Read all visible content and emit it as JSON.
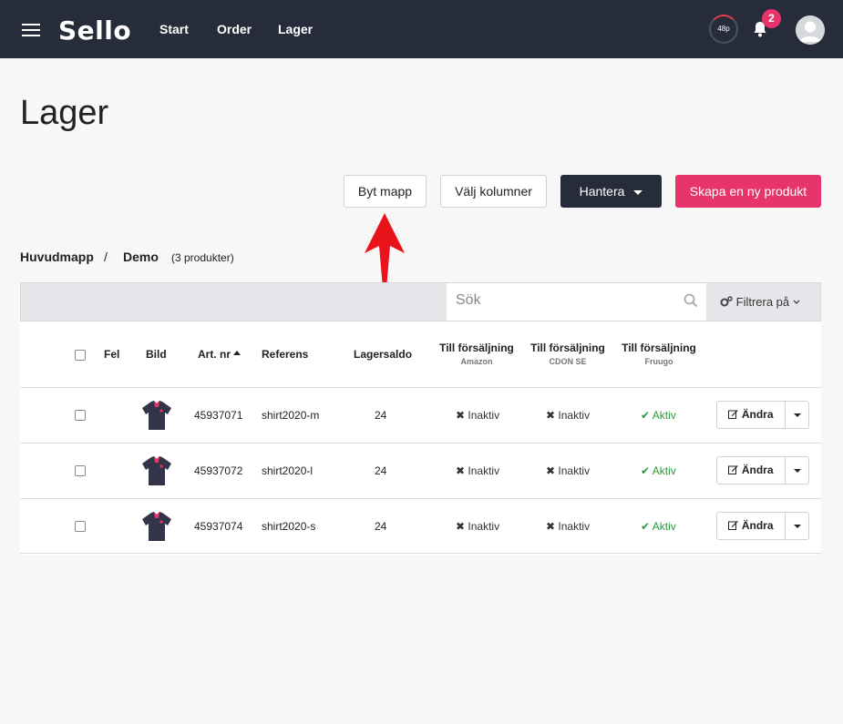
{
  "header": {
    "logo": "Sello",
    "nav": [
      "Start",
      "Order",
      "Lager"
    ],
    "speed_label": "48p",
    "notification_count": "2"
  },
  "page": {
    "title": "Lager"
  },
  "toolbar": {
    "change_folder": "Byt mapp",
    "select_columns": "Välj kolumner",
    "manage": "Hantera",
    "create_product": "Skapa en ny produkt"
  },
  "breadcrumb": {
    "root": "Huvudmapp",
    "separator": "/",
    "current": "Demo",
    "count": "(3 produkter)"
  },
  "search": {
    "placeholder": "Sök",
    "filter_label": "Filtrera på"
  },
  "table": {
    "columns": {
      "error": "Fel",
      "image": "Bild",
      "art_nr": "Art. nr",
      "reference": "Referens",
      "stock": "Lagersaldo",
      "sale_amazon": "Till försäljning",
      "sale_amazon_sub": "Amazon",
      "sale_cdon": "Till försäljning",
      "sale_cdon_sub": "CDON SE",
      "sale_fruugo": "Till försäljning",
      "sale_fruugo_sub": "Fruugo"
    },
    "rows": [
      {
        "art_nr": "45937071",
        "reference": "shirt2020-m",
        "stock": "24",
        "amazon": "Inaktiv",
        "cdon": "Inaktiv",
        "fruugo": "Aktiv",
        "edit": "Ändra"
      },
      {
        "art_nr": "45937072",
        "reference": "shirt2020-l",
        "stock": "24",
        "amazon": "Inaktiv",
        "cdon": "Inaktiv",
        "fruugo": "Aktiv",
        "edit": "Ändra"
      },
      {
        "art_nr": "45937074",
        "reference": "shirt2020-s",
        "stock": "24",
        "amazon": "Inaktiv",
        "cdon": "Inaktiv",
        "fruugo": "Aktiv",
        "edit": "Ändra"
      }
    ]
  },
  "colors": {
    "topbar": "#272c3a",
    "accent": "#e7346a",
    "active": "#2a9a3a",
    "arrow": "#e8131b"
  }
}
